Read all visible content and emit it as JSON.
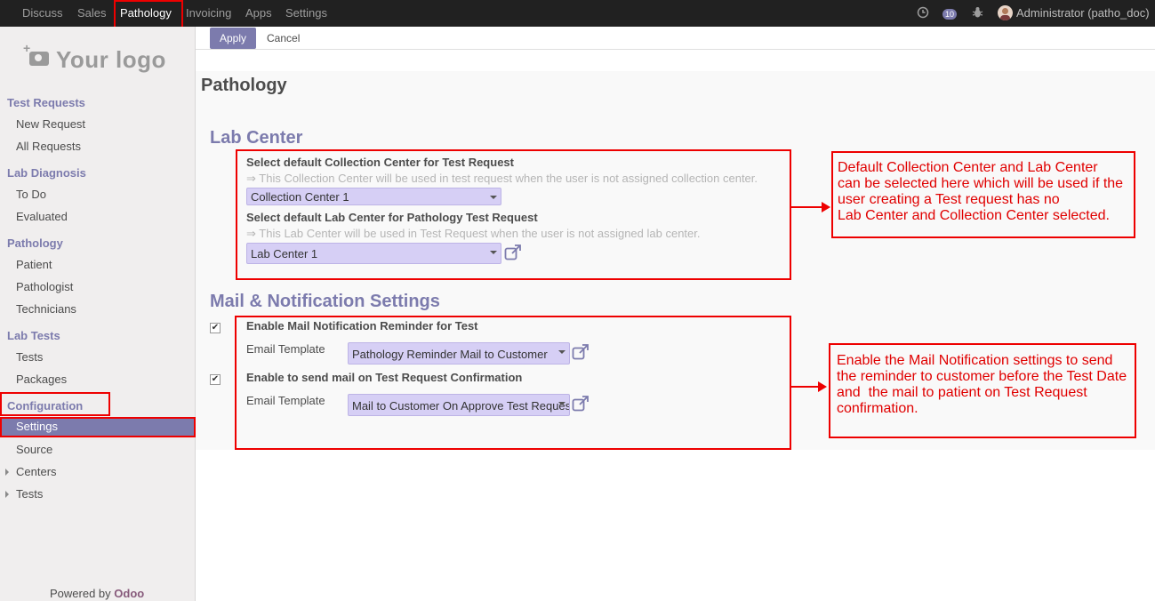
{
  "topbar": {
    "menus": [
      "Discuss",
      "Sales",
      "Pathology",
      "Invoicing",
      "Apps",
      "Settings"
    ],
    "active": "Pathology",
    "messages_count": "10",
    "user": "Administrator (patho_doc)"
  },
  "sidebar": {
    "logo_text": "Your logo",
    "sections": [
      {
        "title": "Test Requests",
        "items": [
          "New Request",
          "All Requests"
        ]
      },
      {
        "title": "Lab Diagnosis",
        "items": [
          "To Do",
          "Evaluated"
        ]
      },
      {
        "title": "Pathology",
        "items": [
          "Patient",
          "Pathologist",
          "Technicians"
        ]
      },
      {
        "title": "Lab Tests",
        "items": [
          "Tests",
          "Packages"
        ]
      },
      {
        "title": "Configuration",
        "items": [
          "Settings",
          "Source",
          "Centers",
          "Tests"
        ]
      }
    ],
    "active_item": "Settings",
    "powered_by": "Powered by",
    "powered_brand": "Odoo"
  },
  "control_panel": {
    "apply_label": "Apply",
    "cancel_label": "Cancel"
  },
  "page": {
    "title": "Pathology",
    "lab_center": {
      "heading": "Lab Center",
      "collection_label": "Select default Collection Center for Test Request",
      "collection_help": "⇒ This Collection Center will be used in test request when the user is not assigned collection center.",
      "collection_value": "Collection Center 1",
      "lab_label": "Select default Lab Center for Pathology Test Request",
      "lab_help": "⇒ This Lab Center will be used in Test Request when the user is not assigned lab center.",
      "lab_value": "Lab Center 1"
    },
    "mail": {
      "heading": "Mail & Notification Settings",
      "reminder_label": "Enable Mail Notification Reminder for Test",
      "reminder_checked": true,
      "template_label": "Email Template",
      "reminder_template": "Pathology Reminder Mail to Customer",
      "confirm_label": "Enable to send mail on Test Request Confirmation",
      "confirm_checked": true,
      "confirm_template": "Mail to Customer On Approve Test Request"
    }
  },
  "annotations": {
    "lab_note": "Default Collection Center and Lab Center\ncan be selected here which will be used if the\nuser creating a Test request has no\nLab Center and Collection Center selected.",
    "mail_note": "Enable the Mail Notification settings to send\nthe reminder to customer before the Test Date\nand  the mail to patient on Test Request\nconfirmation."
  },
  "colors": {
    "accent": "#7c7bad",
    "annotation": "#ee0000",
    "topbar": "#212121"
  }
}
